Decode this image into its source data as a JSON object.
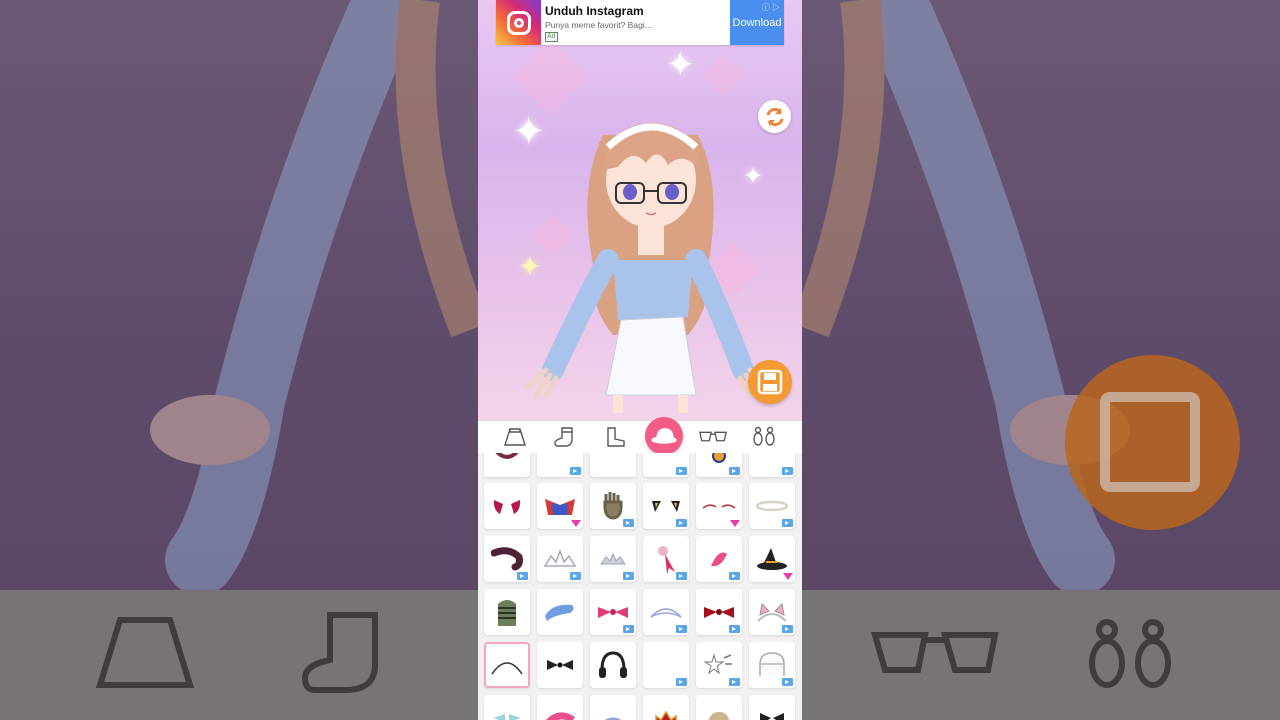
{
  "ad": {
    "title": "Unduh Instagram",
    "subtitle": "Punya meme favorit? Bagi...",
    "badge": "Ad",
    "button": "Download",
    "info": "ⓘ ▷"
  },
  "colors": {
    "accent_pink": "#f25c86",
    "save_orange": "#f49a32",
    "ad_blue": "#4a8ef0",
    "badge_blue": "#5ba6e6",
    "gem_pink": "#e23fa8"
  },
  "categories": [
    {
      "name": "skirt-icon",
      "active": false
    },
    {
      "name": "socks-icon",
      "active": false
    },
    {
      "name": "boots-icon",
      "active": false
    },
    {
      "name": "hat-icon",
      "active": true
    },
    {
      "name": "glasses-icon",
      "active": false
    },
    {
      "name": "earrings-icon",
      "active": false
    }
  ],
  "items": [
    {
      "name": "item-horns-red",
      "badge": "none"
    },
    {
      "name": "item-jester-hat",
      "badge": "gem"
    },
    {
      "name": "item-hand-thing",
      "badge": "video"
    },
    {
      "name": "item-cat-ears-black",
      "badge": "video"
    },
    {
      "name": "item-eyebrow-lines",
      "badge": "gem"
    },
    {
      "name": "item-halo",
      "badge": "video"
    },
    {
      "name": "item-snake-band",
      "badge": "video"
    },
    {
      "name": "item-tiara-silver",
      "badge": "video"
    },
    {
      "name": "item-tiara-small",
      "badge": "video"
    },
    {
      "name": "item-flower-bow",
      "badge": "video"
    },
    {
      "name": "item-pink-flower",
      "badge": "video"
    },
    {
      "name": "item-witch-hat",
      "badge": "gem"
    },
    {
      "name": "item-striped-beanie",
      "badge": "none"
    },
    {
      "name": "item-blue-beret",
      "badge": "none"
    },
    {
      "name": "item-pink-bow",
      "badge": "video"
    },
    {
      "name": "item-maid-headband",
      "badge": "video"
    },
    {
      "name": "item-red-bow",
      "badge": "video"
    },
    {
      "name": "item-cat-ears-pink",
      "badge": "video"
    },
    {
      "name": "item-white-headband",
      "badge": "none",
      "selected": true
    },
    {
      "name": "item-black-bow",
      "badge": "none"
    },
    {
      "name": "item-headphones",
      "badge": "none"
    },
    {
      "name": "item-clear",
      "badge": "video"
    },
    {
      "name": "item-star-clip",
      "badge": "video"
    },
    {
      "name": "item-white-helmet",
      "badge": "video"
    }
  ]
}
